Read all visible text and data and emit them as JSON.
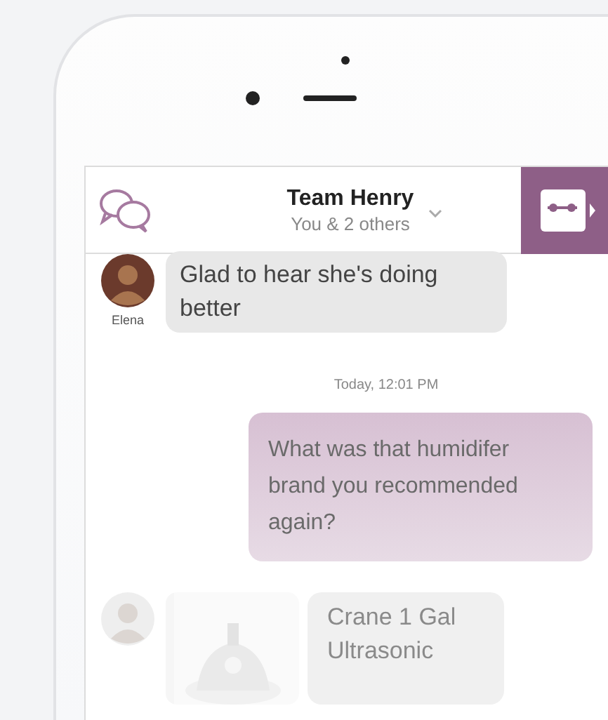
{
  "header": {
    "title": "Team Henry",
    "subtitle": "You & 2 others"
  },
  "messages": [
    {
      "kind": "incoming",
      "sender": "Elena",
      "text": "Glad to hear she's doing better"
    },
    {
      "kind": "timestamp",
      "text": "Today, 12:01 PM"
    },
    {
      "kind": "outgoing",
      "text": "What was that humidifer brand you recommended again?"
    },
    {
      "kind": "product",
      "text": "Crane 1 Gal Ultrasonic"
    }
  ]
}
